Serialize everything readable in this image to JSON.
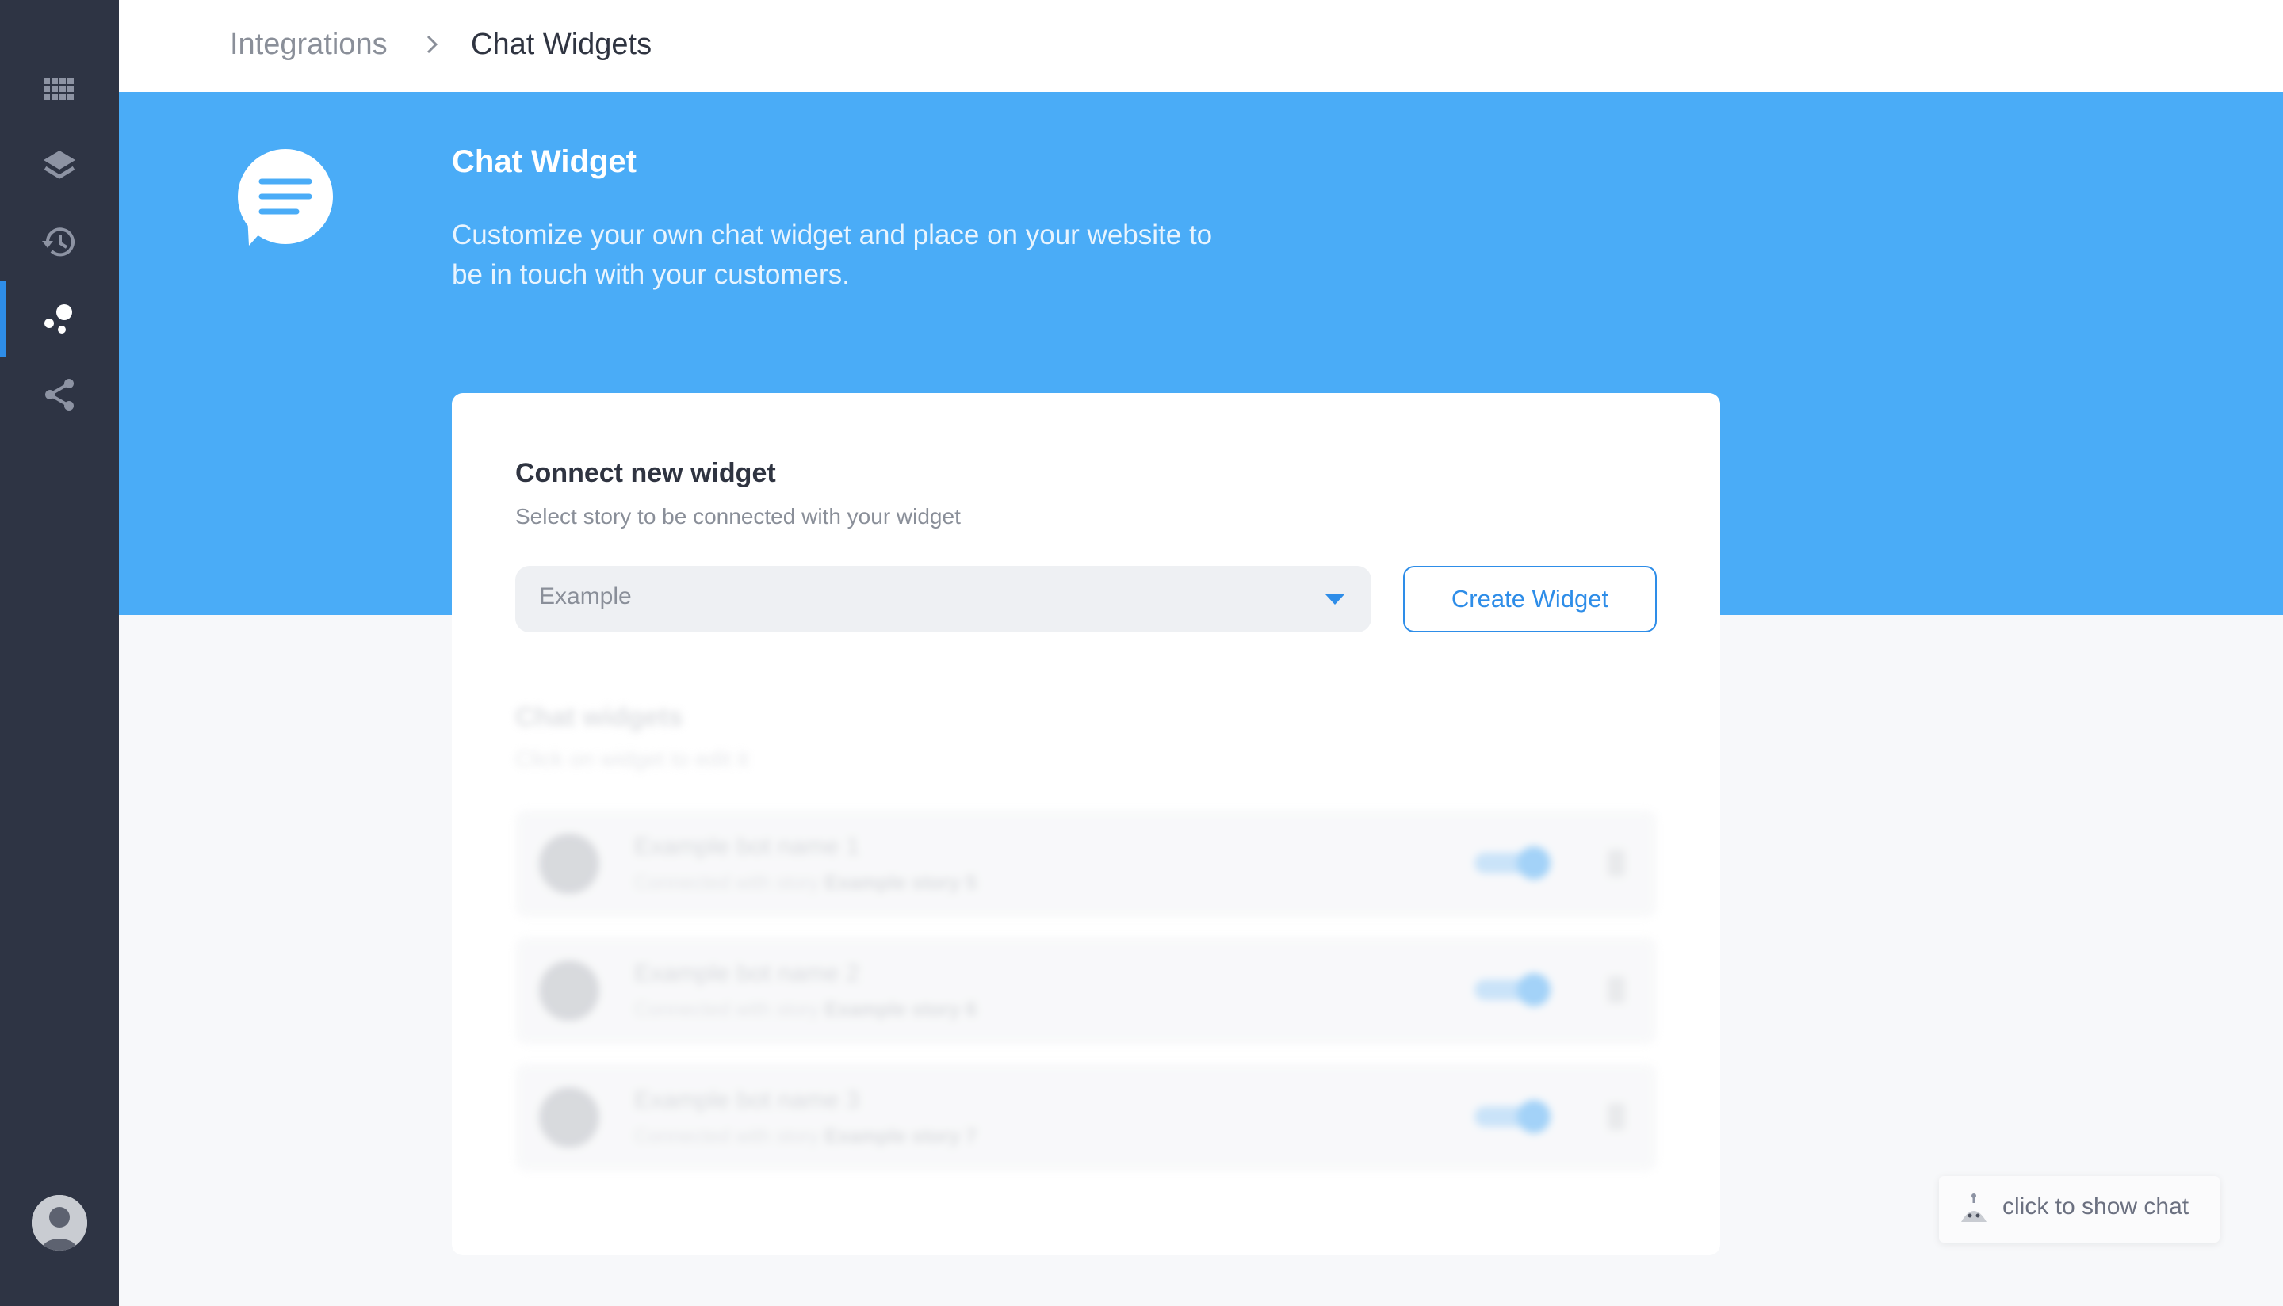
{
  "sidebar": {
    "items": [
      {
        "name": "apps-grid",
        "icon": "grid-icon",
        "active": false
      },
      {
        "name": "layers",
        "icon": "layers-icon",
        "active": false
      },
      {
        "name": "history",
        "icon": "history-icon",
        "active": false
      },
      {
        "name": "integrations",
        "icon": "integrations-icon",
        "active": true
      },
      {
        "name": "share",
        "icon": "share-icon",
        "active": false
      }
    ],
    "accent": "#2e8de8",
    "background": "#2e3444"
  },
  "breadcrumb": {
    "parent": "Integrations",
    "current": "Chat Widgets"
  },
  "hero": {
    "icon": "chat-bubble-icon",
    "title": "Chat Widget",
    "description": "Customize your own chat widget and place on your website to be in touch with your customers.",
    "background": "#4aacf7"
  },
  "connect": {
    "title": "Connect new widget",
    "subtitle": "Select story to be connected with your widget",
    "select_value": "Example",
    "create_button": "Create Widget"
  },
  "widgets": {
    "title": "Chat widgets",
    "subtitle": "Click on widget to edit it",
    "items": [
      {
        "name": "Example bot name 1",
        "prefix": "Connected with story",
        "story": "Example story 5",
        "enabled": true
      },
      {
        "name": "Example bot name 2",
        "prefix": "Connected with story",
        "story": "Example story 6",
        "enabled": true
      },
      {
        "name": "Example bot name 3",
        "prefix": "Connected with story",
        "story": "Example story 7",
        "enabled": true
      }
    ]
  },
  "chat_launcher": {
    "label": "click to show chat",
    "icon": "bot-icon"
  }
}
